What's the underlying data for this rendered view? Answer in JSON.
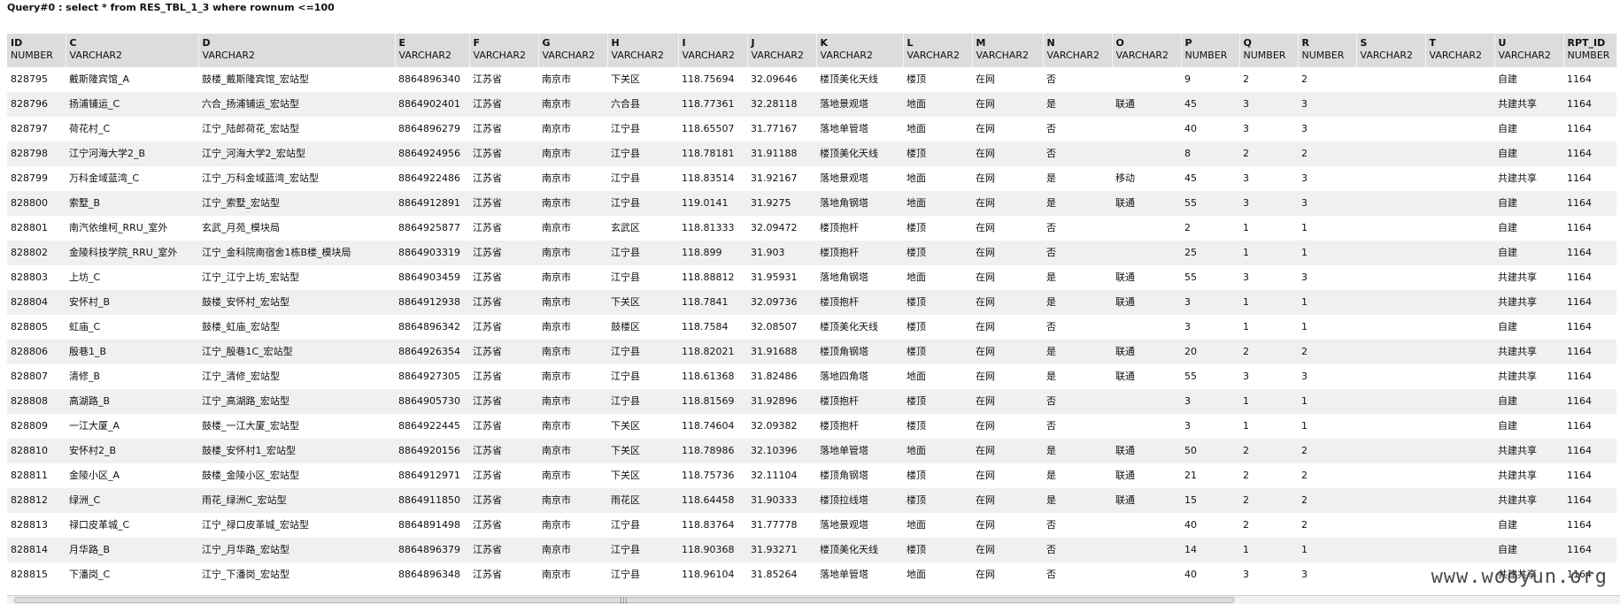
{
  "query_title": "Query#0 : select * from RES_TBL_1_3 where rownum <=100",
  "columns": [
    {
      "name": "ID",
      "type": "NUMBER"
    },
    {
      "name": "C",
      "type": "VARCHAR2"
    },
    {
      "name": "D",
      "type": "VARCHAR2"
    },
    {
      "name": "E",
      "type": "VARCHAR2"
    },
    {
      "name": "F",
      "type": "VARCHAR2"
    },
    {
      "name": "G",
      "type": "VARCHAR2"
    },
    {
      "name": "H",
      "type": "VARCHAR2"
    },
    {
      "name": "I",
      "type": "VARCHAR2"
    },
    {
      "name": "J",
      "type": "VARCHAR2"
    },
    {
      "name": "K",
      "type": "VARCHAR2"
    },
    {
      "name": "L",
      "type": "VARCHAR2"
    },
    {
      "name": "M",
      "type": "VARCHAR2"
    },
    {
      "name": "N",
      "type": "VARCHAR2"
    },
    {
      "name": "O",
      "type": "VARCHAR2"
    },
    {
      "name": "P",
      "type": "NUMBER"
    },
    {
      "name": "Q",
      "type": "NUMBER"
    },
    {
      "name": "R",
      "type": "NUMBER"
    },
    {
      "name": "S",
      "type": "VARCHAR2"
    },
    {
      "name": "T",
      "type": "VARCHAR2"
    },
    {
      "name": "U",
      "type": "VARCHAR2"
    },
    {
      "name": "RPT_ID",
      "type": "NUMBER"
    }
  ],
  "rows": [
    [
      "828795",
      "戴斯隆宾馆_A",
      "鼓楼_戴斯隆宾馆_宏站型",
      "8864896340",
      "江苏省",
      "南京市",
      "下关区",
      "118.75694",
      "32.09646",
      "楼顶美化天线",
      "楼顶",
      "在网",
      "否",
      "",
      "9",
      "2",
      "2",
      "",
      "",
      "自建",
      "1164"
    ],
    [
      "828796",
      "扬浦铺运_C",
      "六合_扬浦铺运_宏站型",
      "8864902401",
      "江苏省",
      "南京市",
      "六合县",
      "118.77361",
      "32.28118",
      "落地景观塔",
      "地面",
      "在网",
      "是",
      "联通",
      "45",
      "3",
      "3",
      "",
      "",
      "共建共享",
      "1164"
    ],
    [
      "828797",
      "荷花村_C",
      "江宁_陆郎荷花_宏站型",
      "8864896279",
      "江苏省",
      "南京市",
      "江宁县",
      "118.65507",
      "31.77167",
      "落地单管塔",
      "地面",
      "在网",
      "否",
      "",
      "40",
      "3",
      "3",
      "",
      "",
      "自建",
      "1164"
    ],
    [
      "828798",
      "江宁河海大学2_B",
      "江宁_河海大学2_宏站型",
      "8864924956",
      "江苏省",
      "南京市",
      "江宁县",
      "118.78181",
      "31.91188",
      "楼顶美化天线",
      "楼顶",
      "在网",
      "否",
      "",
      "8",
      "2",
      "2",
      "",
      "",
      "自建",
      "1164"
    ],
    [
      "828799",
      "万科金域蓝湾_C",
      "江宁_万科金域蓝湾_宏站型",
      "8864922486",
      "江苏省",
      "南京市",
      "江宁县",
      "118.83514",
      "31.92167",
      "落地景观塔",
      "地面",
      "在网",
      "是",
      "移动",
      "45",
      "3",
      "3",
      "",
      "",
      "共建共享",
      "1164"
    ],
    [
      "828800",
      "索墅_B",
      "江宁_索墅_宏站型",
      "8864912891",
      "江苏省",
      "南京市",
      "江宁县",
      "119.0141",
      "31.9275",
      "落地角钢塔",
      "地面",
      "在网",
      "是",
      "联通",
      "55",
      "3",
      "3",
      "",
      "",
      "自建",
      "1164"
    ],
    [
      "828801",
      "南汽依维柯_RRU_室外",
      "玄武_月苑_模块局",
      "8864925877",
      "江苏省",
      "南京市",
      "玄武区",
      "118.81333",
      "32.09472",
      "楼顶抱杆",
      "楼顶",
      "在网",
      "否",
      "",
      "2",
      "1",
      "1",
      "",
      "",
      "自建",
      "1164"
    ],
    [
      "828802",
      "金陵科技学院_RRU_室外",
      "江宁_金科院南宿舍1栋B楼_模块局",
      "8864903319",
      "江苏省",
      "南京市",
      "江宁县",
      "118.899",
      "31.903",
      "楼顶抱杆",
      "楼顶",
      "在网",
      "否",
      "",
      "25",
      "1",
      "1",
      "",
      "",
      "自建",
      "1164"
    ],
    [
      "828803",
      "上坊_C",
      "江宁_江宁上坊_宏站型",
      "8864903459",
      "江苏省",
      "南京市",
      "江宁县",
      "118.88812",
      "31.95931",
      "落地角钢塔",
      "地面",
      "在网",
      "是",
      "联通",
      "55",
      "3",
      "3",
      "",
      "",
      "共建共享",
      "1164"
    ],
    [
      "828804",
      "安怀村_B",
      "鼓楼_安怀村_宏站型",
      "8864912938",
      "江苏省",
      "南京市",
      "下关区",
      "118.7841",
      "32.09736",
      "楼顶抱杆",
      "楼顶",
      "在网",
      "是",
      "联通",
      "3",
      "1",
      "1",
      "",
      "",
      "共建共享",
      "1164"
    ],
    [
      "828805",
      "虹庙_C",
      "鼓楼_虹庙_宏站型",
      "8864896342",
      "江苏省",
      "南京市",
      "鼓楼区",
      "118.7584",
      "32.08507",
      "楼顶美化天线",
      "楼顶",
      "在网",
      "否",
      "",
      "3",
      "1",
      "1",
      "",
      "",
      "自建",
      "1164"
    ],
    [
      "828806",
      "殷巷1_B",
      "江宁_殷巷1C_宏站型",
      "8864926354",
      "江苏省",
      "南京市",
      "江宁县",
      "118.82021",
      "31.91688",
      "楼顶角钢塔",
      "楼顶",
      "在网",
      "是",
      "联通",
      "20",
      "2",
      "2",
      "",
      "",
      "共建共享",
      "1164"
    ],
    [
      "828807",
      "清修_B",
      "江宁_清修_宏站型",
      "8864927305",
      "江苏省",
      "南京市",
      "江宁县",
      "118.61368",
      "31.82486",
      "落地四角塔",
      "地面",
      "在网",
      "是",
      "联通",
      "55",
      "3",
      "3",
      "",
      "",
      "共建共享",
      "1164"
    ],
    [
      "828808",
      "高湖路_B",
      "江宁_高湖路_宏站型",
      "8864905730",
      "江苏省",
      "南京市",
      "江宁县",
      "118.81569",
      "31.92896",
      "楼顶抱杆",
      "楼顶",
      "在网",
      "否",
      "",
      "3",
      "1",
      "1",
      "",
      "",
      "自建",
      "1164"
    ],
    [
      "828809",
      "一江大厦_A",
      "鼓楼_一江大厦_宏站型",
      "8864922445",
      "江苏省",
      "南京市",
      "下关区",
      "118.74604",
      "32.09382",
      "楼顶抱杆",
      "楼顶",
      "在网",
      "否",
      "",
      "3",
      "1",
      "1",
      "",
      "",
      "自建",
      "1164"
    ],
    [
      "828810",
      "安怀村2_B",
      "鼓楼_安怀村1_宏站型",
      "8864920156",
      "江苏省",
      "南京市",
      "下关区",
      "118.78986",
      "32.10396",
      "落地单管塔",
      "地面",
      "在网",
      "是",
      "联通",
      "50",
      "2",
      "2",
      "",
      "",
      "共建共享",
      "1164"
    ],
    [
      "828811",
      "金陵小区_A",
      "鼓楼_金陵小区_宏站型",
      "8864912971",
      "江苏省",
      "南京市",
      "下关区",
      "118.75736",
      "32.11104",
      "楼顶角钢塔",
      "楼顶",
      "在网",
      "是",
      "联通",
      "21",
      "2",
      "2",
      "",
      "",
      "共建共享",
      "1164"
    ],
    [
      "828812",
      "绿洲_C",
      "雨花_绿洲C_宏站型",
      "8864911850",
      "江苏省",
      "南京市",
      "雨花区",
      "118.64458",
      "31.90333",
      "楼顶拉线塔",
      "楼顶",
      "在网",
      "是",
      "联通",
      "15",
      "2",
      "2",
      "",
      "",
      "共建共享",
      "1164"
    ],
    [
      "828813",
      "禄口皮革城_C",
      "江宁_禄口皮革城_宏站型",
      "8864891498",
      "江苏省",
      "南京市",
      "江宁县",
      "118.83764",
      "31.77778",
      "落地景观塔",
      "地面",
      "在网",
      "否",
      "",
      "40",
      "2",
      "2",
      "",
      "",
      "自建",
      "1164"
    ],
    [
      "828814",
      "月华路_B",
      "江宁_月华路_宏站型",
      "8864896379",
      "江苏省",
      "南京市",
      "江宁县",
      "118.90368",
      "31.93271",
      "楼顶美化天线",
      "楼顶",
      "在网",
      "否",
      "",
      "14",
      "1",
      "1",
      "",
      "",
      "自建",
      "1164"
    ],
    [
      "828815",
      "下潘岗_C",
      "江宁_下潘岗_宏站型",
      "8864896348",
      "江苏省",
      "南京市",
      "江宁县",
      "118.96104",
      "31.85264",
      "落地单管塔",
      "地面",
      "在网",
      "否",
      "",
      "40",
      "3",
      "3",
      "",
      "",
      "共建共享",
      "1164"
    ]
  ],
  "scrollbar": {
    "grip": "|||"
  },
  "watermark": "www.wooyun.org"
}
